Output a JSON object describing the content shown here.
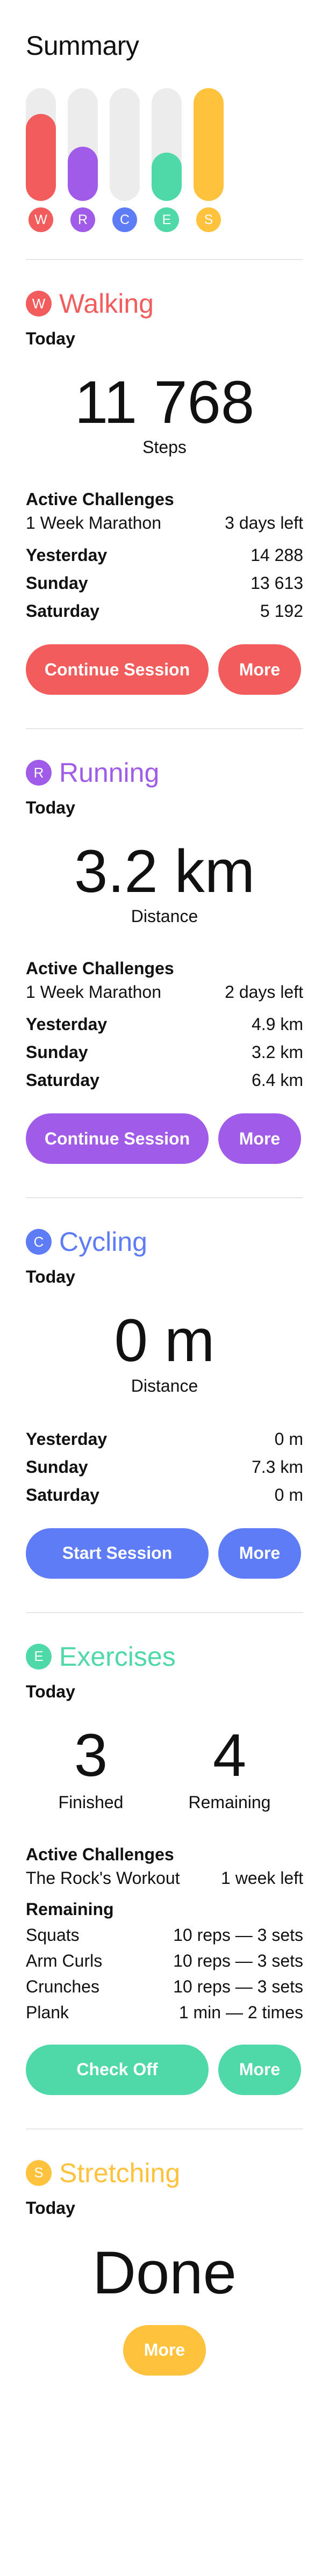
{
  "summary": {
    "title": "Summary",
    "bars": [
      {
        "letter": "W",
        "level": 0.77,
        "color": "#f25c5c"
      },
      {
        "letter": "R",
        "level": 0.48,
        "color": "#a05ce8"
      },
      {
        "letter": "C",
        "level": 0.0,
        "color": "#5f7cf7"
      },
      {
        "letter": "E",
        "level": 0.43,
        "color": "#4fd9a8"
      },
      {
        "letter": "S",
        "level": 1.0,
        "color": "#ffc23d"
      }
    ]
  },
  "walking": {
    "badge": "W",
    "title": "Walking",
    "color": "#f25c5c",
    "today_label": "Today",
    "value": "11 768",
    "unit_label": "Steps",
    "challenges_label": "Active Challenges",
    "challenge": {
      "name": "1 Week Marathon",
      "status": "3 days left"
    },
    "history": [
      {
        "day": "Yesterday",
        "value": "14 288"
      },
      {
        "day": "Sunday",
        "value": "13 613"
      },
      {
        "day": "Saturday",
        "value": "5 192"
      }
    ],
    "primary_button": "Continue Session",
    "more_button": "More"
  },
  "running": {
    "badge": "R",
    "title": "Running",
    "color": "#a05ce8",
    "today_label": "Today",
    "value": "3.2 km",
    "unit_label": "Distance",
    "challenges_label": "Active Challenges",
    "challenge": {
      "name": "1 Week Marathon",
      "status": "2 days left"
    },
    "history": [
      {
        "day": "Yesterday",
        "value": "4.9 km"
      },
      {
        "day": "Sunday",
        "value": "3.2 km"
      },
      {
        "day": "Saturday",
        "value": "6.4 km"
      }
    ],
    "primary_button": "Continue Session",
    "more_button": "More"
  },
  "cycling": {
    "badge": "C",
    "title": "Cycling",
    "color": "#5f7cf7",
    "today_label": "Today",
    "value": "0 m",
    "unit_label": "Distance",
    "history": [
      {
        "day": "Yesterday",
        "value": "0 m"
      },
      {
        "day": "Sunday",
        "value": "7.3 km"
      },
      {
        "day": "Saturday",
        "value": "0 m"
      }
    ],
    "primary_button": "Start Session",
    "more_button": "More"
  },
  "exercises": {
    "badge": "E",
    "title": "Exercises",
    "color": "#4fd9a8",
    "today_label": "Today",
    "finished": "3",
    "finished_label": "Finished",
    "remaining": "4",
    "remaining_label": "Remaining",
    "challenges_label": "Active Challenges",
    "challenge": {
      "name": "The Rock's Workout",
      "status": "1 week left"
    },
    "remaining_header": "Remaining",
    "items": [
      {
        "name": "Squats",
        "detail": "10 reps — 3 sets"
      },
      {
        "name": "Arm Curls",
        "detail": "10 reps — 3 sets"
      },
      {
        "name": "Crunches",
        "detail": "10 reps — 3 sets"
      },
      {
        "name": "Plank",
        "detail": "1 min — 2 times"
      }
    ],
    "primary_button": "Check Off",
    "more_button": "More"
  },
  "stretching": {
    "badge": "S",
    "title": "Stretching",
    "color": "#ffc23d",
    "today_label": "Today",
    "value": "Done",
    "more_button": "More"
  }
}
